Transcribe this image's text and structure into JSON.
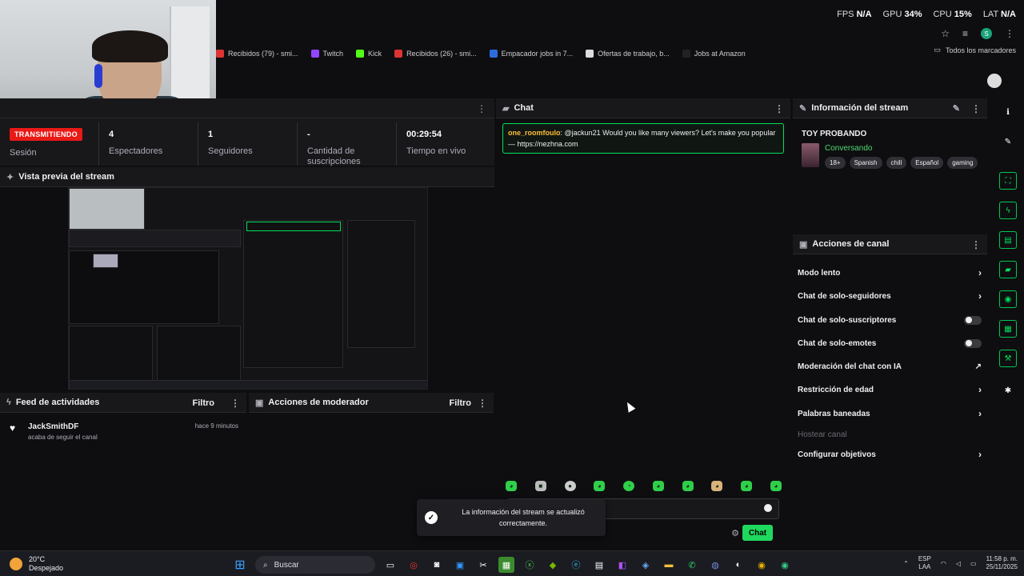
{
  "perf": {
    "fps_label": "FPS",
    "fps_value": "N/A",
    "gpu_label": "GPU",
    "gpu_value": "34%",
    "cpu_label": "CPU",
    "cpu_value": "15%",
    "lat_label": "LAT",
    "lat_value": "N/A"
  },
  "bookmarks": [
    {
      "label": "Recibidos (79) - smi...",
      "color": "#d33"
    },
    {
      "label": "Twitch",
      "color": "#9146ff"
    },
    {
      "label": "Kick",
      "color": "#53fc18"
    },
    {
      "label": "Recibidos (26) - smi...",
      "color": "#d33"
    },
    {
      "label": "Empacador jobs in 7...",
      "color": "#2d6cdf"
    },
    {
      "label": "Ofertas de trabajo, b...",
      "color": "#ddd"
    },
    {
      "label": "Jobs at Amazon",
      "color": "#222"
    }
  ],
  "bookmarks_folder": "Todos los marcadores",
  "stats": {
    "live_badge": "TRANSMITIENDO",
    "session_label": "Sesión",
    "viewers_value": "4",
    "viewers_label": "Espectadores",
    "followers_value": "1",
    "followers_label": "Seguidores",
    "subs_value": "-",
    "subs_label": "Cantidad de suscripciones",
    "uptime_value": "00:29:54",
    "uptime_label": "Tiempo en vivo"
  },
  "preview": {
    "title": "Vista previa del stream"
  },
  "feed": {
    "title": "Feed de actividades",
    "filter": "Filtro",
    "items": [
      {
        "user": "JackSmithDF",
        "action": "acaba de seguir el canal",
        "time": "hace 9 minutos"
      }
    ]
  },
  "mod_actions": {
    "title": "Acciones de moderador",
    "filter": "Filtro"
  },
  "chat": {
    "title": "Chat",
    "message_user": "one_roomfoulo",
    "message_text": ": @jackun21 Would you like many viewers? Let's make you popular — https://nezhna.com",
    "send_label": "Chat"
  },
  "toast": {
    "message": "La información del stream se actualizó correctamente."
  },
  "stream_info": {
    "title": "Información del stream",
    "stream_title": "TOY PROBANDO",
    "category": "Conversando",
    "tags": [
      "18+",
      "Spanish",
      "chill",
      "Español",
      "gaming"
    ]
  },
  "channel_actions": {
    "title": "Acciones de canal",
    "items": [
      {
        "label": "Modo lento",
        "control": "chevron"
      },
      {
        "label": "Chat de solo-seguidores",
        "control": "chevron"
      },
      {
        "label": "Chat de solo-suscriptores",
        "control": "toggle"
      },
      {
        "label": "Chat de solo-emotes",
        "control": "toggle"
      },
      {
        "label": "Moderación del chat con IA",
        "control": "external"
      },
      {
        "label": "Restricción de edad",
        "control": "chevron"
      },
      {
        "label": "Palabras baneadas",
        "control": "chevron"
      },
      {
        "label": "Hostear canal",
        "control": "none"
      },
      {
        "label": "Configurar objetivos",
        "control": "chevron"
      }
    ]
  },
  "taskbar": {
    "weather_temp": "20°C",
    "weather_desc": "Despejado",
    "search_placeholder": "Buscar",
    "lang_top": "ESP",
    "lang_bottom": "LAA",
    "time": "11:58 p. m.",
    "date": "25/11/2025"
  }
}
